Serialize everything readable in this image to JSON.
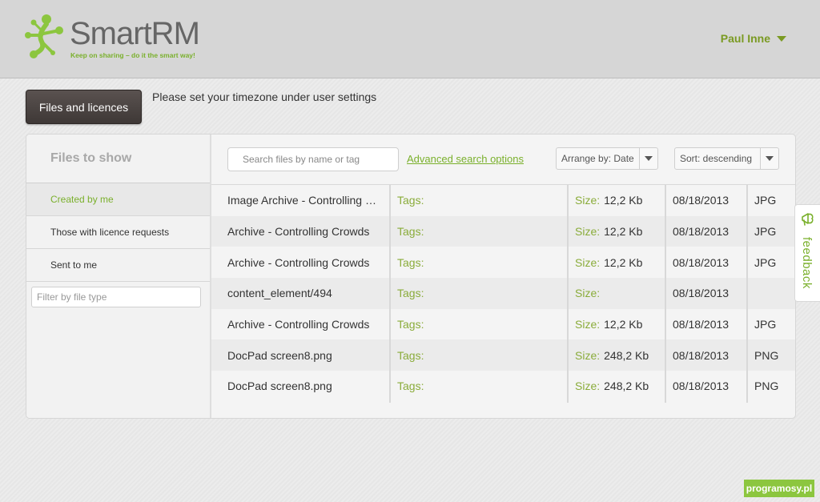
{
  "header": {
    "logo_text": "SmartRM",
    "logo_tagline": "Keep on sharing – do it the smart way!",
    "user_name": "Paul Inne"
  },
  "action_button": "Files and licences",
  "notice": "Please set your timezone under user settings",
  "sidebar": {
    "title": "Files to show",
    "items": [
      {
        "label": "Created by me",
        "active": true
      },
      {
        "label": "Those with licence requests",
        "active": false
      },
      {
        "label": "Sent to me",
        "active": false
      }
    ],
    "filter_placeholder": "Filter by file type"
  },
  "toolbar": {
    "search_placeholder": "Search files by name or tag",
    "advanced_link": "Advanced search options",
    "arrange_label": "Arrange by: Date",
    "sort_label": "Sort: descending"
  },
  "columns": {
    "tags_label": "Tags:",
    "size_label": "Size:"
  },
  "files": [
    {
      "name": "Image Archive - Controlling Crowds",
      "size": "12,2 Kb",
      "date": "08/18/2013",
      "type": "JPG"
    },
    {
      "name": "Archive - Controlling Crowds",
      "size": "12,2 Kb",
      "date": "08/18/2013",
      "type": "JPG"
    },
    {
      "name": "Archive - Controlling Crowds",
      "size": "12,2 Kb",
      "date": "08/18/2013",
      "type": "JPG"
    },
    {
      "name": "content_element/494",
      "size": "",
      "date": "08/18/2013",
      "type": ""
    },
    {
      "name": "Archive - Controlling Crowds",
      "size": "12,2 Kb",
      "date": "08/18/2013",
      "type": "JPG"
    },
    {
      "name": "DocPad screen8.png",
      "size": "248,2 Kb",
      "date": "08/18/2013",
      "type": "PNG"
    },
    {
      "name": "DocPad screen8.png",
      "size": "248,2 Kb",
      "date": "08/18/2013",
      "type": "PNG"
    }
  ],
  "feedback_label": "feedback",
  "watermark": "programosy.pl",
  "colors": {
    "accent": "#7ab02c",
    "button_dark": "#4a4341"
  }
}
